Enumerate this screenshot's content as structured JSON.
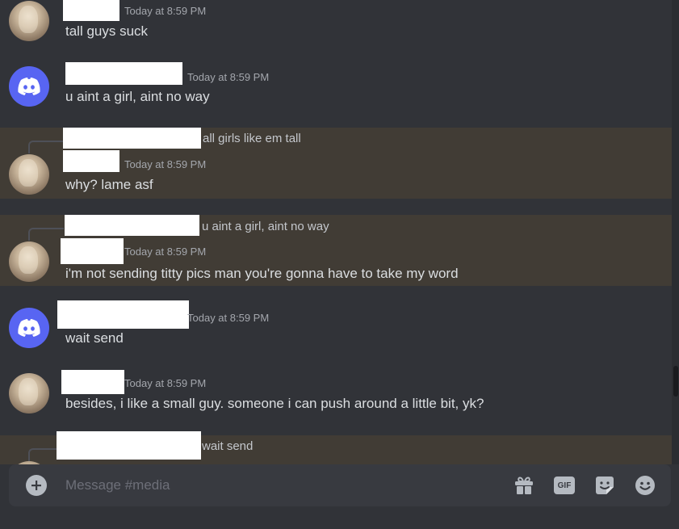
{
  "messages": [
    {
      "timestamp": "Today at 8:59 PM",
      "text": "tall guys suck"
    },
    {
      "timestamp": "Today at 8:59 PM",
      "text": "u aint a girl, aint no way"
    },
    {
      "reply": "all girls like em tall",
      "timestamp": "Today at 8:59 PM",
      "text": "why? lame asf"
    },
    {
      "reply": "u aint a girl, aint no way",
      "timestamp": "Today at 8:59 PM",
      "text": "i'm not sending titty pics man you're gonna have to take my word"
    },
    {
      "timestamp": "Today at 8:59 PM",
      "text": "wait send"
    },
    {
      "timestamp": "Today at 8:59 PM",
      "text": "besides, i like a small guy. someone i can push around a little bit, yk?"
    },
    {
      "reply": "wait send"
    }
  ],
  "composer": {
    "placeholder": "Message #media",
    "gif_label": "GIF"
  },
  "icons": [
    "plus-icon",
    "gift-icon",
    "gif-icon",
    "sticker-icon",
    "emoji-icon",
    "discord-logo-icon"
  ],
  "colors": {
    "background": "#313338",
    "highlight": "#413c35",
    "composer": "#383a40",
    "discord_blurple": "#5865f2"
  }
}
